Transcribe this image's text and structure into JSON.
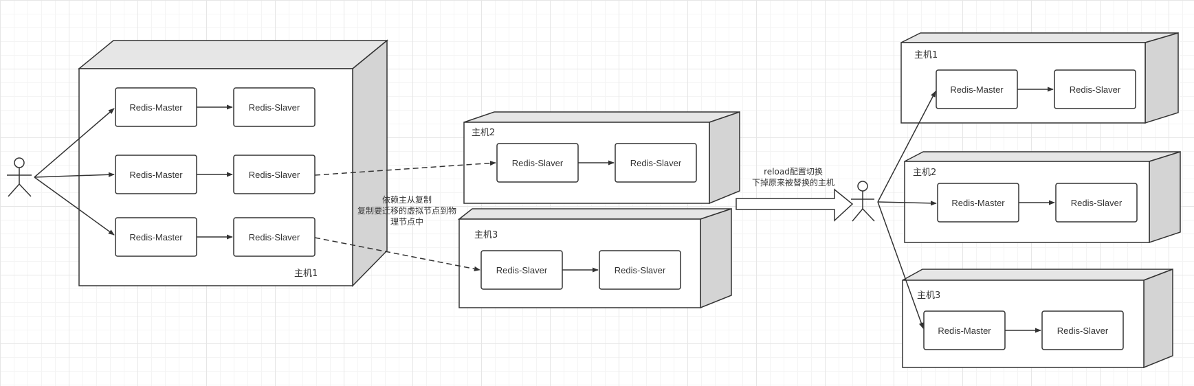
{
  "colors": {
    "line": "#333333",
    "cube_top": "#e6e6e6",
    "cube_side": "#d4d4d4",
    "box_fill": "#ffffff"
  },
  "left_host": {
    "label": "主机1",
    "rows": [
      {
        "master": "Redis-Master",
        "slaver": "Redis-Slaver"
      },
      {
        "master": "Redis-Master",
        "slaver": "Redis-Slaver"
      },
      {
        "master": "Redis-Master",
        "slaver": "Redis-Slaver"
      }
    ]
  },
  "migration_note": {
    "lines": [
      "依赖主从复制",
      "复制要迁移的虚拟节点到物",
      "理节点中"
    ]
  },
  "middle_hosts": [
    {
      "label": "主机2",
      "first": "Redis-Slaver",
      "second": "Redis-Slaver"
    },
    {
      "label": "主机3",
      "first": "Redis-Slaver",
      "second": "Redis-Slaver"
    }
  ],
  "reload_note": {
    "lines": [
      "reload配置切换",
      "下掉原来被替换的主机"
    ]
  },
  "right_hosts": [
    {
      "label": "主机1",
      "master": "Redis-Master",
      "slaver": "Redis-Slaver"
    },
    {
      "label": "主机2",
      "master": "Redis-Master",
      "slaver": "Redis-Slaver"
    },
    {
      "label": "主机3",
      "master": "Redis-Master",
      "slaver": "Redis-Slaver"
    }
  ],
  "actors": [
    {
      "role": "client-left"
    },
    {
      "role": "client-right"
    }
  ]
}
